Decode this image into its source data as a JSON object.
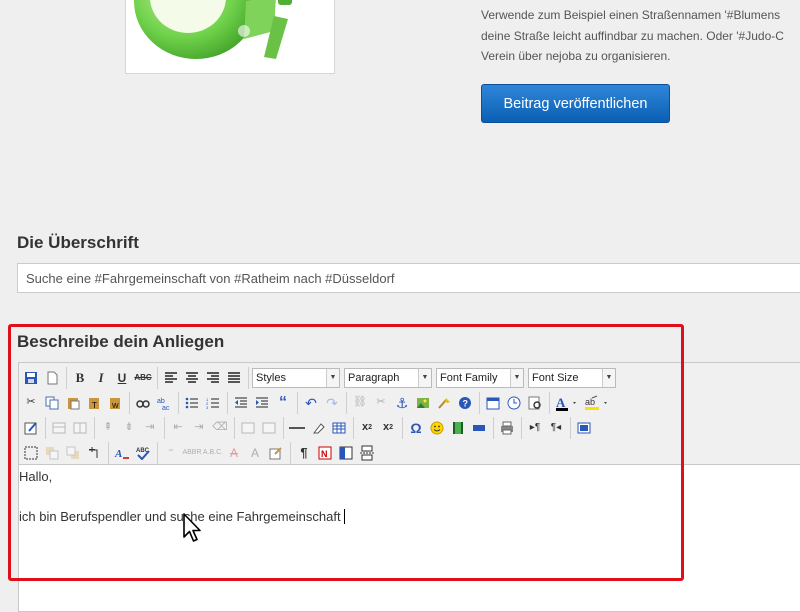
{
  "intro": {
    "lines": [
      "Verwende zum Beispiel einen Straßennamen '#Blumens",
      "deine Straße leicht auffindbar zu machen. Oder '#Judo-C",
      "Verein über nejoba zu organisieren."
    ]
  },
  "publish_button": {
    "label": "Beitrag veröffentlichen"
  },
  "headline": {
    "heading": "Die Überschrift",
    "value": "Suche eine #Fahrgemeinschaft von #Ratheim nach #Düsseldorf"
  },
  "description": {
    "heading": "Beschreibe dein Anliegen",
    "toolbar": {
      "styles": "Styles",
      "format": "Paragraph",
      "font_family": "Font Family",
      "font_size": "Font Size"
    },
    "content": {
      "line1": "Hallo,",
      "line2": "ich bin Berufspendler und suche eine Fahrgemeinschaft"
    }
  },
  "colors": {
    "primary_button": "#1a6fc4",
    "highlight_frame": "#e0101a",
    "icon_green": "#5cc23a"
  }
}
